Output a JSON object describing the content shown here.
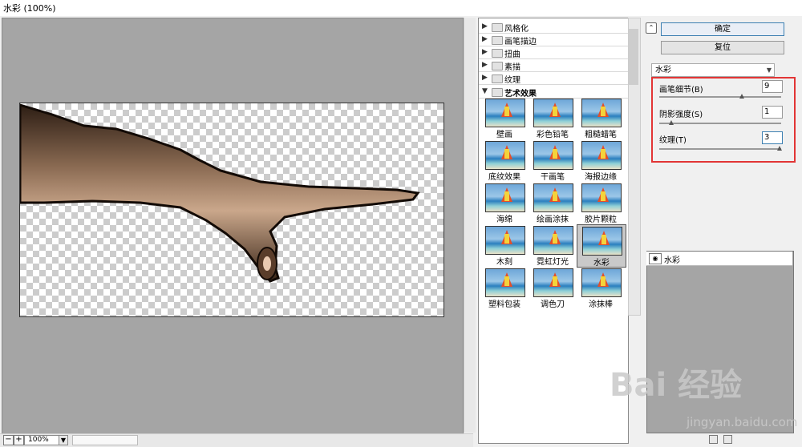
{
  "window": {
    "title": "水彩 (100%)"
  },
  "preview": {
    "zoom": "100%"
  },
  "gallery": {
    "categories": [
      {
        "label": "风格化",
        "expanded": false
      },
      {
        "label": "画笔描边",
        "expanded": false
      },
      {
        "label": "扭曲",
        "expanded": false
      },
      {
        "label": "素描",
        "expanded": false
      },
      {
        "label": "纹理",
        "expanded": false
      },
      {
        "label": "艺术效果",
        "expanded": true
      }
    ],
    "filters": [
      "壁画",
      "彩色铅笔",
      "粗糙蜡笔",
      "底纹效果",
      "干画笔",
      "海报边缘",
      "海绵",
      "绘画涂抹",
      "胶片颗粒",
      "木刻",
      "霓虹灯光",
      "水彩",
      "塑料包装",
      "调色刀",
      "涂抹棒"
    ],
    "selected_filter": "水彩"
  },
  "panel": {
    "ok_label": "确定",
    "reset_label": "复位",
    "selected_filter": "水彩",
    "params": [
      {
        "label": "画笔细节(B)",
        "value": "9",
        "level": 0.69
      },
      {
        "label": "阴影强度(S)",
        "value": "1",
        "level": 0.1
      },
      {
        "label": "纹理(T)",
        "value": "3",
        "level": 1.0
      }
    ]
  },
  "layers": {
    "items": [
      {
        "name": "水彩",
        "visible": true
      }
    ]
  },
  "watermark": {
    "text": "Bai 经验",
    "url": "jingyan.baidu.com"
  }
}
